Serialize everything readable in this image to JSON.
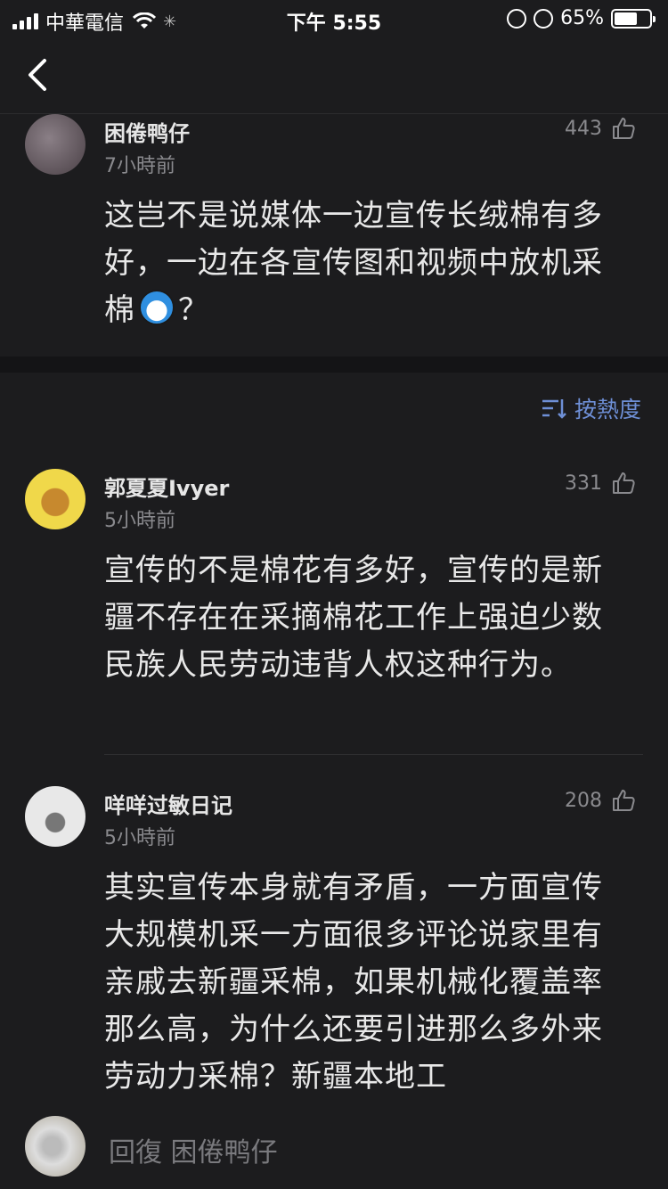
{
  "status_bar": {
    "carrier": "中華電信",
    "time": "下午 5:55",
    "battery": "65%",
    "battery_level": 0.65
  },
  "top_comment": {
    "username": "困倦鸭仔",
    "time": "7小時前",
    "likes": "443",
    "text": "这岂不是说媒体一边宣传长绒棉有多好，一边在各宣传图和视频中放机采棉",
    "text_suffix": "？",
    "emoji": "doraemon-emoji"
  },
  "sort": {
    "label": "按熱度",
    "icon": "sort-icon",
    "color": "#6e8fd6"
  },
  "replies": [
    {
      "username": "郭夏夏Ivyer",
      "time": "5小時前",
      "likes": "331",
      "text": "宣传的不是棉花有多好，宣传的是新疆不存在在采摘棉花工作上强迫少数民族人民劳动违背人权这种行为。"
    },
    {
      "username": "咩咩过敏日记",
      "time": "5小時前",
      "likes": "208",
      "text": "其实宣传本身就有矛盾，一方面宣传大规模机采一方面很多评论说家里有亲戚去新疆采棉，如果机械化覆盖率那么高，为什么还要引进那么多外来劳动力采棉？新疆本地工"
    }
  ],
  "reply_bar": {
    "placeholder": "回復 困倦鸭仔"
  }
}
